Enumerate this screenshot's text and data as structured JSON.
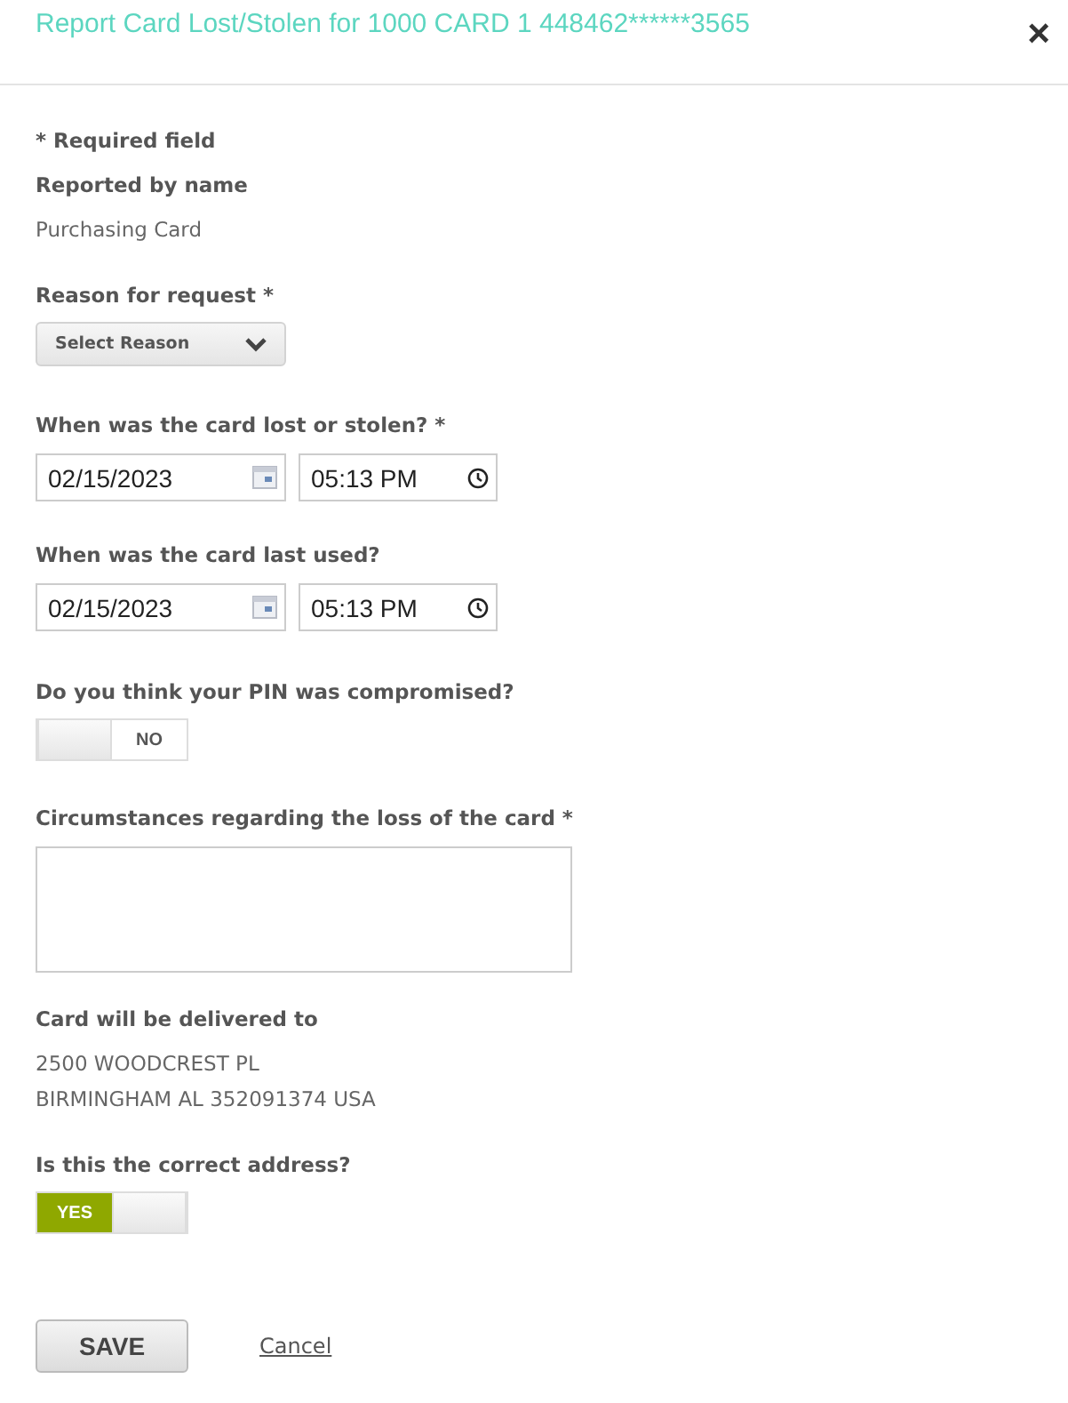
{
  "dialog": {
    "title": "Report Card Lost/Stolen for 1000 CARD 1 448462******3565",
    "close": "×"
  },
  "required_note": "* Required field",
  "reported_by": {
    "label": "Reported by name",
    "value": "Purchasing Card"
  },
  "reason": {
    "label": "Reason for request *",
    "placeholder": "Select Reason"
  },
  "lost_when": {
    "label": "When was the card lost or stolen? *",
    "date": "02/15/2023",
    "time": "05:13 PM"
  },
  "last_used": {
    "label": "When was the card last used?",
    "date": "02/15/2023",
    "time": "05:13 PM"
  },
  "pin_compromised": {
    "label": "Do you think your PIN was compromised?",
    "on": false,
    "state_text": "NO"
  },
  "circumstances": {
    "label": "Circumstances regarding the loss of the card *"
  },
  "delivery": {
    "label": "Card will be delivered to",
    "lines": [
      "2500 WOODCREST PL",
      "BIRMINGHAM AL 352091374 USA"
    ]
  },
  "address_correct": {
    "label": "Is this the correct address?",
    "on": true,
    "state_text": "YES"
  },
  "buttons": {
    "save": "SAVE",
    "cancel": "Cancel"
  }
}
